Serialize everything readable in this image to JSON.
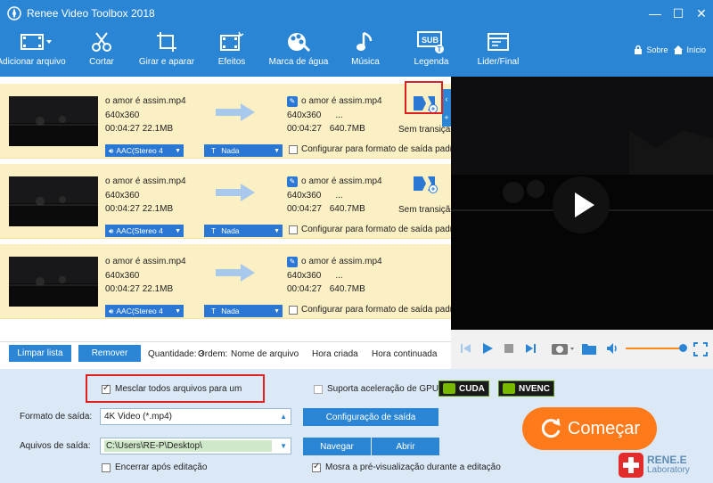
{
  "window": {
    "title": "Renee Video Toolbox 2018",
    "controls": [
      "minimize-icon",
      "maximize-icon",
      "close-icon"
    ]
  },
  "toolbar": {
    "items": [
      {
        "label": "Adicionar arquivo",
        "icon": "add-file-icon"
      },
      {
        "label": "Cortar",
        "icon": "scissors-icon"
      },
      {
        "label": "Girar e aparar",
        "icon": "crop-rotate-icon"
      },
      {
        "label": "Efeitos",
        "icon": "effects-film-icon"
      },
      {
        "label": "Marca de água",
        "icon": "watermark-icon"
      },
      {
        "label": "Música",
        "icon": "music-note-icon"
      },
      {
        "label": "Legenda",
        "icon": "subtitle-icon"
      },
      {
        "label": "Lider/Final",
        "icon": "intro-outro-icon"
      }
    ],
    "about": "Sobre",
    "home": "Início"
  },
  "files": [
    {
      "name": "o amor é assim.mp4",
      "resolution": "640x360",
      "duration": "00:04:27",
      "size": "22.1MB",
      "out_name": "o amor é assim.mp4",
      "out_resolution": "640x360",
      "out_extra": "...",
      "out_duration": "00:04:27",
      "out_size": "640.7MB",
      "transition": "Sem transição",
      "audio": "AAC(Stereo 4",
      "subtitle": "Nada",
      "config_label": "Configurar para formato de saída padrão",
      "config_checked": false
    },
    {
      "name": "o amor é assim.mp4",
      "resolution": "640x360",
      "duration": "00:04:27",
      "size": "22.1MB",
      "out_name": "o amor é assim.mp4",
      "out_resolution": "640x360",
      "out_extra": "...",
      "out_duration": "00:04:27",
      "out_size": "640.7MB",
      "transition": "Sem transição",
      "audio": "AAC(Stereo 4",
      "subtitle": "Nada",
      "config_label": "Configurar para formato de saída padrão",
      "config_checked": false
    },
    {
      "name": "o amor é assim.mp4",
      "resolution": "640x360",
      "duration": "00:04:27",
      "size": "22.1MB",
      "out_name": "o amor é assim.mp4",
      "out_resolution": "640x360",
      "out_extra": "...",
      "out_duration": "00:04:27",
      "out_size": "640.7MB",
      "transition": "",
      "audio": "AAC(Stereo 4",
      "subtitle": "Nada",
      "config_label": "Configurar para formato de saída padrão",
      "config_checked": false
    }
  ],
  "list_bar": {
    "clear_label": "Limpar lista",
    "remove_label": "Remover",
    "quantity_label": "Quantidade: 3",
    "order_label": "Ordem:",
    "sort_name": "Nome de arquivo",
    "sort_created": "Hora criada",
    "sort_continuous": "Hora continuada"
  },
  "bottom": {
    "merge_label": "Mesclar todos arquivos para um",
    "merge_checked": true,
    "gpu_label": "Suporta aceleração de GPU",
    "gpu_checked": false,
    "cuda": "CUDA",
    "nvenc": "NVENC",
    "format_label": "Formato de saída:",
    "format_value": "4K Video (*.mp4)",
    "config_btn": "Configuração de saída",
    "folder_label": "Aquivos de saída:",
    "folder_value": "C:\\Users\\RE-P\\Desktop\\",
    "browse_btn": "Navegar",
    "open_btn": "Abrir",
    "shutdown_label": "Encerrar após editação",
    "shutdown_checked": false,
    "preview_label": "Mosra a pré-visualização durante a editação",
    "preview_checked": true,
    "start_label": "Começar"
  },
  "brand": {
    "line1": "RENE.E",
    "line2": "Laboratory"
  },
  "colors": {
    "accent": "#2a86d4",
    "row_bg": "#fbefc4",
    "start": "#ff7a1a",
    "highlight": "#e02020"
  }
}
